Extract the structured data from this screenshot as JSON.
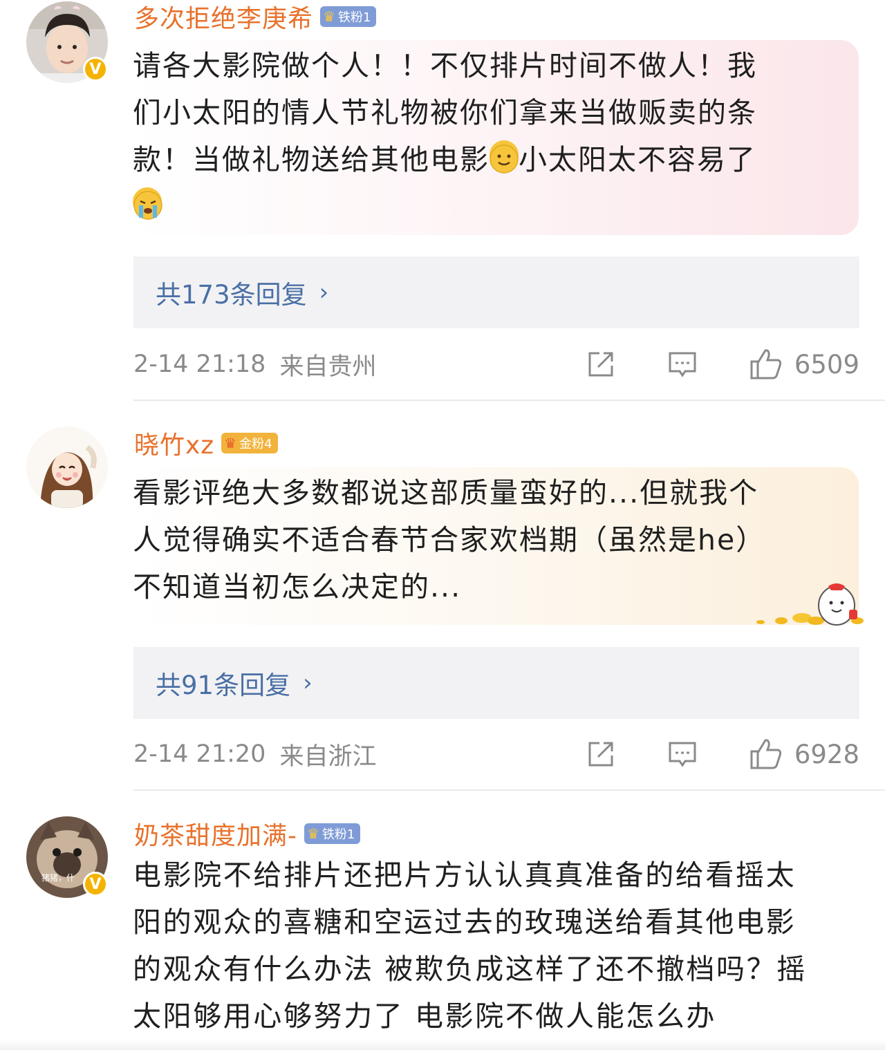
{
  "comments": [
    {
      "username": "多次拒绝李庚希",
      "badge": "铁粉1",
      "text_lines": [
        "请各大影院做个人！！不仅排片时间不做人！我",
        "们小太阳的情人节礼物被你们拿来当做贩卖的条",
        "款！当做礼物送给其他电影",
        "小太阳太不容易了"
      ],
      "replies_label": "共173条回复",
      "time": "2-14 21:18",
      "location": "来自贵州",
      "likes": "6509"
    },
    {
      "username": "晓竹xz",
      "badge": "金粉4",
      "text_lines": [
        "看影评绝大多数都说这部质量蛮好的...但就我个",
        "人觉得确实不适合春节合家欢档期（虽然是he）",
        "不知道当初怎么决定的..."
      ],
      "replies_label": "共91条回复",
      "time": "2-14 21:20",
      "location": "来自浙江",
      "likes": "6928"
    },
    {
      "username": "奶茶甜度加满-",
      "badge": "铁粉1",
      "avatar_caption": "猪猪，什",
      "text_lines": [
        "电影院不给排片还把片方认认真真准备的给看摇太",
        "阳的观众的喜糖和空运过去的玫瑰送给看其他电影",
        "的观众有什么办法 被欺负成这样了还不撤档吗？摇",
        "太阳够用心够努力了 电影院不做人能怎么办"
      ]
    }
  ],
  "icons": {
    "verified": "verified-v-icon",
    "badge_crown": "crown-icon",
    "share": "share-icon",
    "comment": "comment-icon",
    "like": "thumbs-up-icon",
    "chevron": "chevron-right-icon"
  },
  "colors": {
    "username": "#e8712b",
    "reply_link": "#4a6fa5",
    "meta_gray": "#8a8a8a",
    "verified_gold": "#f5b301"
  }
}
